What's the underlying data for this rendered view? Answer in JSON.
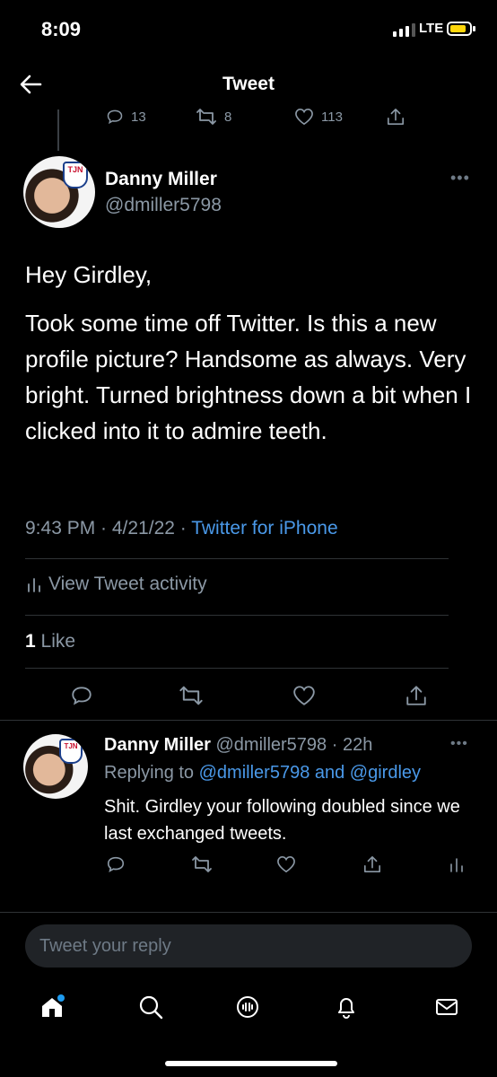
{
  "status_bar": {
    "time": "8:09",
    "network": "LTE",
    "battery_color": "#ffd60a"
  },
  "header": {
    "title": "Tweet"
  },
  "previous_tweet": {
    "replies": "13",
    "retweets": "8",
    "likes": "113"
  },
  "main_tweet": {
    "author": {
      "name": "Danny Miller",
      "handle": "@dmiller5798",
      "badge_text": "TJN"
    },
    "paragraphs": [
      "Hey Girdley,",
      "Took some time off Twitter. Is this a new profile picture? Handsome as always. Very bright. Turned brightness down a bit when I clicked into it to admire teeth."
    ],
    "timestamp": "9:43 PM · 4/21/22 · ",
    "source": "Twitter for iPhone",
    "activity_label": "View Tweet activity",
    "likes_count": "1",
    "likes_label": " Like"
  },
  "reply_tweet": {
    "author": {
      "name": "Danny Miller",
      "meta": "@dmiller5798 · 22h",
      "badge_text": "TJN"
    },
    "replying_prefix": "Replying to ",
    "replying_to": "@dmiller5798 and @girdley",
    "text": "Shit. Girdley your following doubled since we last exchanged tweets."
  },
  "reply_input": {
    "placeholder": "Tweet your reply"
  },
  "colors": {
    "accent": "#4a99e9",
    "background": "#000000",
    "muted": "#8b98a5",
    "divider": "#2f3336"
  }
}
